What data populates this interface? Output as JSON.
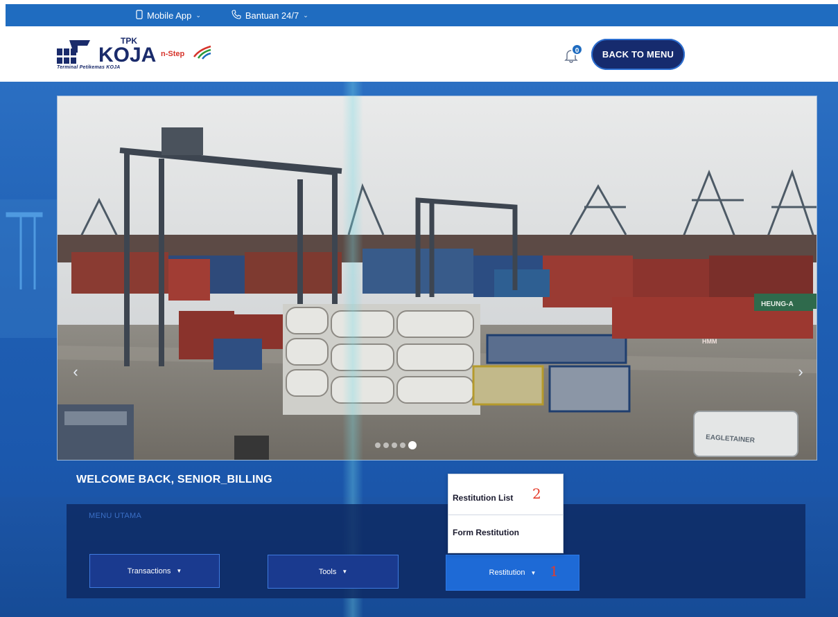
{
  "topbar": {
    "mobile_app": "Mobile App",
    "support": "Bantuan 24/7"
  },
  "header": {
    "logo": {
      "tpk": "TPK",
      "koja": "KOJA",
      "nstep": "n-Step",
      "subtitle": "Terminal Petikemas KOJA"
    },
    "notification_count": "0",
    "back_to_menu": "BACK TO MENU"
  },
  "carousel": {
    "slide_count": 5,
    "active_index": 4,
    "container_labels": [
      "HEUNG-A",
      "EAGLETAINER",
      "HMM"
    ]
  },
  "welcome": "WELCOME BACK, SENIOR_BILLING",
  "menu": {
    "title": "MENU UTAMA",
    "buttons": {
      "transactions": "Transactions",
      "tools": "Tools",
      "restitution": "Restitution"
    },
    "restitution_dropdown": [
      "Restitution List",
      "Form Restitution"
    ]
  },
  "annotations": {
    "step_1": "1",
    "step_2": "2"
  },
  "colors": {
    "topbar": "#1f6cc0",
    "brand_navy": "#162b6e",
    "menu_button": "#1a3a8f",
    "active_button": "#1e6ad6",
    "annotation_red": "#e53b2a"
  }
}
